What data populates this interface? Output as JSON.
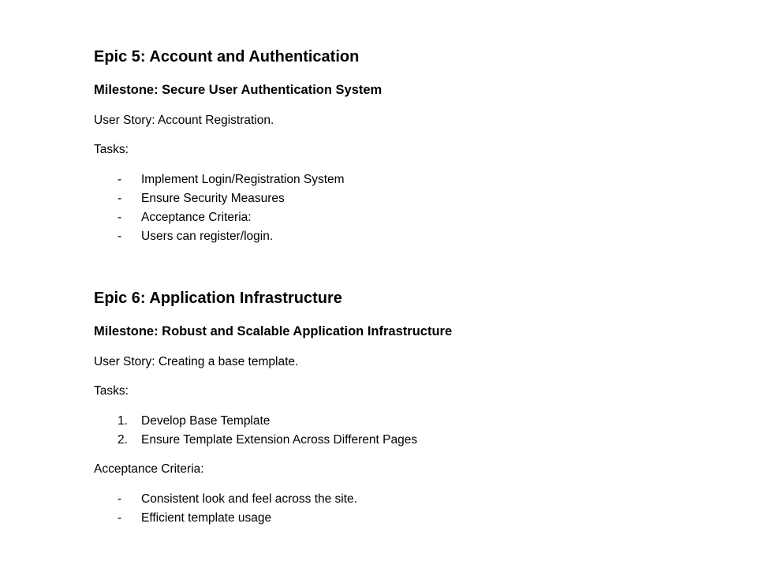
{
  "epic5": {
    "title": "Epic 5: Account and Authentication",
    "milestone": "Milestone: Secure User Authentication System",
    "user_story": "User Story: Account Registration.",
    "tasks_label": "Tasks:",
    "tasks": [
      {
        "marker": "-",
        "text": "Implement Login/Registration System"
      },
      {
        "marker": "-",
        "text": "Ensure Security Measures"
      },
      {
        "marker": "-",
        "text": "Acceptance Criteria:"
      },
      {
        "marker": "-",
        "text": "Users can register/login."
      }
    ]
  },
  "epic6": {
    "title": "Epic 6: Application Infrastructure",
    "milestone": "Milestone: Robust and Scalable Application Infrastructure",
    "user_story": "User Story: Creating a base template.",
    "tasks_label": "Tasks:",
    "tasks": [
      {
        "marker": "1.",
        "text": "Develop Base Template"
      },
      {
        "marker": "2.",
        "text": "Ensure Template Extension Across Different Pages"
      }
    ],
    "acceptance_label": "Acceptance Criteria:",
    "acceptance": [
      {
        "marker": "-",
        "text": "Consistent look and feel across the site."
      },
      {
        "marker": "-",
        "text": "Efficient template usage"
      }
    ]
  }
}
